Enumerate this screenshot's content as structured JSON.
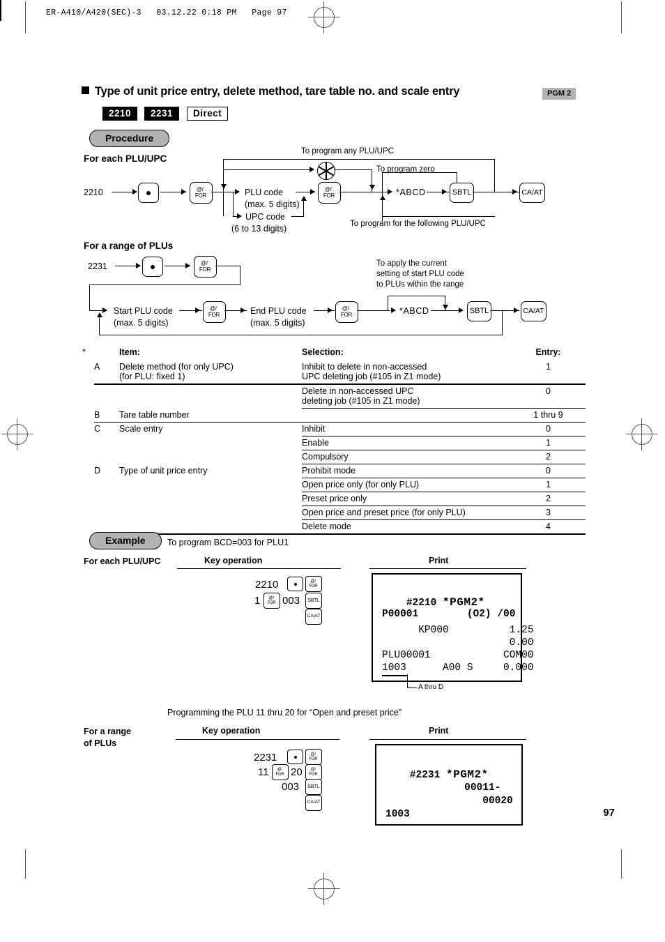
{
  "page_header": "ER-A410/A420(SEC)-3   03.12.22 0:18 PM   Page 97",
  "page_number": "97",
  "section": {
    "title": "Type of unit price entry, delete method, tare table no. and scale entry",
    "mode_badge": "PGM 2",
    "codes": [
      "2210",
      "2231"
    ],
    "direct_label": "Direct",
    "procedure_label": "Procedure",
    "example_label": "Example"
  },
  "flow1": {
    "heading": "For each PLU/UPC",
    "start": "2210",
    "note_top": "To program any PLU/UPC",
    "note_zero": "To program zero",
    "note_following": "To program for the following PLU/UPC",
    "plu_code": "PLU code",
    "plu_code_sub": "(max. 5 digits)",
    "upc_code": "UPC code",
    "upc_code_sub": "(6 to 13 digits)",
    "abcd": "*ABCD",
    "keys": {
      "dot": "·",
      "for_top": "@/",
      "for_bottom": "FOR",
      "sbtl": "SBTL",
      "caat": "CA/AT"
    }
  },
  "flow2": {
    "heading": "For a range of PLUs",
    "start": "2231",
    "start_plu": "Start PLU code",
    "start_plu_sub": "(max. 5 digits)",
    "end_plu": "End PLU code",
    "end_plu_sub": "(max. 5 digits)",
    "abcd": "*ABCD",
    "note_apply": [
      "To apply the current",
      "setting of start PLU code",
      "to PLUs within the range"
    ]
  },
  "table": {
    "asterisk": "*",
    "headers": [
      "Item:",
      "Selection:",
      "Entry:"
    ],
    "rows": [
      {
        "letter": "A",
        "item": [
          "Delete method (for only UPC)",
          "(for PLU: fixed 1)"
        ],
        "selections": [
          {
            "text": [
              "Inhibit to delete in non-accessed",
              "UPC deleting job (#105 in Z1 mode)"
            ],
            "entry": "1"
          },
          {
            "text": [
              "Delete in non-accessed UPC",
              "deleting job (#105 in Z1 mode)"
            ],
            "entry": "0"
          }
        ]
      },
      {
        "letter": "B",
        "item": [
          "Tare table number"
        ],
        "selections": [
          {
            "text": [
              ""
            ],
            "entry": "1 thru 9"
          }
        ]
      },
      {
        "letter": "C",
        "item": [
          "Scale entry"
        ],
        "selections": [
          {
            "text": [
              "Inhibit"
            ],
            "entry": "0"
          },
          {
            "text": [
              "Enable"
            ],
            "entry": "1"
          },
          {
            "text": [
              "Compulsory"
            ],
            "entry": "2"
          }
        ]
      },
      {
        "letter": "D",
        "item": [
          "Type of unit price entry"
        ],
        "selections": [
          {
            "text": [
              "Prohibit mode"
            ],
            "entry": "0"
          },
          {
            "text": [
              "Open price only (for only PLU)"
            ],
            "entry": "1"
          },
          {
            "text": [
              "Preset price only"
            ],
            "entry": "2"
          },
          {
            "text": [
              "Open price and preset price (for only PLU)"
            ],
            "entry": "3"
          },
          {
            "text": [
              "Delete mode"
            ],
            "entry": "4"
          }
        ]
      }
    ]
  },
  "example1": {
    "description": "To program BCD=003 for PLU1",
    "row_label": "For each PLU/UPC",
    "key_operation_header": "Key operation",
    "print_header": "Print",
    "keys_line1": "2210",
    "keys_line2a": "1",
    "keys_line2b": "003",
    "receipt": {
      "line1": "#2210 ",
      "line1b": "*PGM2*",
      "line2": "P00001        (O2) /00",
      "line3": "      KP000          1.25",
      "line4": "                     0.00",
      "line5": "PLU00001            COM00",
      "line6": "1003      A00 S     0.000"
    },
    "callout": "A thru D"
  },
  "example2": {
    "description": "Programming the PLU 11 thru 20 for “Open and preset price”",
    "row_label_line1": "For a range",
    "row_label_line2": "of PLUs",
    "key_operation_header": "Key operation",
    "print_header": "Print",
    "keys_line1": "2231",
    "keys_line2a": "11",
    "keys_line2b": "20",
    "keys_line3": "003",
    "receipt": {
      "line1": "#2231 ",
      "line1b": "*PGM2*",
      "line2": "             00011-",
      "line3": "                00020",
      "line4": "1003"
    }
  }
}
